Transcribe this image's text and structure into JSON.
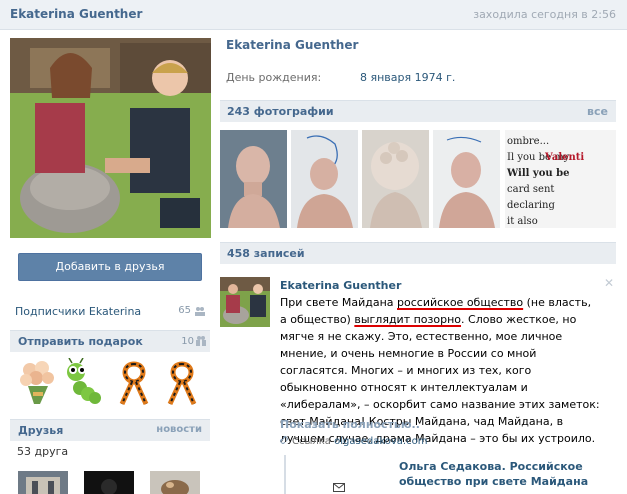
{
  "topbar": {
    "name": "Ekaterina Guenther",
    "status": "заходила сегодня в 2:56"
  },
  "actions": {
    "add_friend": "Добавить в друзья"
  },
  "subscribers": {
    "label": "Подписчики Ekaterina",
    "count": "65"
  },
  "gifts_block": {
    "title": "Отправить подарок",
    "count": "10"
  },
  "friends_block": {
    "title": "Друзья",
    "link": "новости",
    "count_text": "53 друга"
  },
  "profile": {
    "name": "Ekaterina Guenther",
    "birthday_label": "День рождения:",
    "birthday_value": "8 января 1974 г."
  },
  "photos_block": {
    "title": "243 фотографии",
    "link": "все"
  },
  "wall_block": {
    "title": "458 записей"
  },
  "post": {
    "author": "Ekaterina Guenther",
    "text_part1": "При свете Майдана ",
    "text_part2": "российское общество",
    "text_part3": " (не власть, а общество) ",
    "text_part4": "выглядит позорно",
    "text_part5": ". Слово жесткое, но мягче я не скажу. Это, естественно, мое личное мнение, и очень немногие в России со мной согласятся. Многих – и многих из тех, кого обыкновенно относят к интеллектуалам и «либералам», – оскорбит само название этих заметок: свет Майдана! Костры Майдана, чад Майдана, в лучшем случае, драма Майдана – это бы их устроило.",
    "show_more": "Показать полностью..",
    "link_prefix": "Ссылка",
    "link_url": "olgasedakova.com",
    "attach_title": "Ольга Седакова. Российское общество при свете Майдана"
  },
  "colors": {
    "link": "#2b587a",
    "header": "#45688e",
    "button": "#5e82a8",
    "highlight": "#dd0000"
  }
}
